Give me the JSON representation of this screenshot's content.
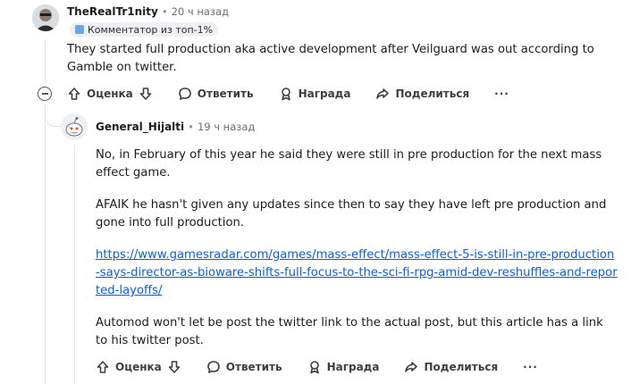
{
  "comment1": {
    "username": "TheRealTr1nity",
    "time": "20 ч назад",
    "flair": "Комментатор из топ-1%",
    "body": "They started full production aka active development after Veilguard was out according to Gamble on twitter.",
    "actions": {
      "vote": "Оценка",
      "reply": "Ответить",
      "award": "Награда",
      "share": "Поделиться",
      "more": "···"
    }
  },
  "comment2": {
    "username": "General_Hijalti",
    "time": "19 ч назад",
    "paragraphs": [
      "No, in February of this year he said they were still in pre production for the next mass effect game.",
      "AFAIK he hasn't given any updates since then to say they have left pre production and gone into full production.",
      "Automod won't let be post the twitter link to the actual post, but this article has a link to his twitter post."
    ],
    "link": "https://www.gamesradar.com/games/mass-effect/mass-effect-5-is-still-in-pre-production-says-director-as-bioware-shifts-full-focus-to-the-sci-fi-rpg-amid-dev-reshuffles-and-reported-layoffs/",
    "actions": {
      "vote": "Оценка",
      "reply": "Ответить",
      "award": "Награда",
      "share": "Поделиться",
      "more": "···"
    }
  },
  "icons": {
    "upvote": "arrow-up-icon",
    "downvote": "arrow-down-icon",
    "reply": "speech-bubble-icon",
    "award": "award-ribbon-icon",
    "share": "share-arrow-icon",
    "more": "more-dots-icon",
    "collapse": "collapse-minus-icon"
  }
}
